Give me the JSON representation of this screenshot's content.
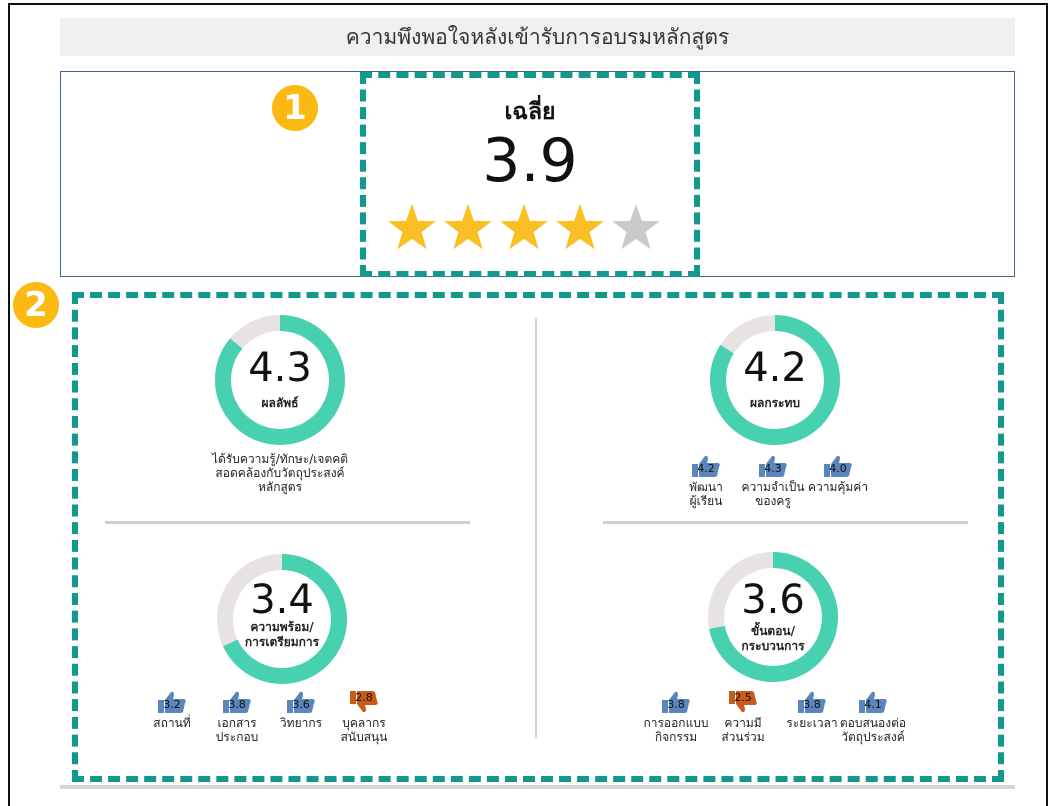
{
  "title": "ความพึงพอใจหลังเข้ารับการอบรมหลักสูตร",
  "average": {
    "label": "เฉลี่ย",
    "value": "3.9",
    "rating": 3.9,
    "stars_filled": 4,
    "stars_total": 5
  },
  "badges": [
    "1",
    "2"
  ],
  "colors": {
    "accent": "#11998e",
    "donut_fill": "#48d1b0",
    "donut_track": "#e8e3e3",
    "star_on": "#fbbf24",
    "star_off": "#c9c9c9",
    "thumb_up": "#5b86bb",
    "thumb_down": "#c75b17"
  },
  "panels": [
    {
      "value": "4.3",
      "score": 4.3,
      "label_lines": [
        "ผลลัพธ์"
      ],
      "description": [
        "ได้รับความรู้/ทักษะ/เจตคติ",
        "สอดคล้องกับวัตถุประสงค์",
        "หลักสูตร"
      ],
      "metrics": []
    },
    {
      "value": "4.2",
      "score": 4.2,
      "label_lines": [
        "ผลกระทบ"
      ],
      "description": [],
      "metrics": [
        {
          "value": "4.2",
          "label": [
            "พัฒนา",
            "ผู้เรียน"
          ],
          "thumb": "up"
        },
        {
          "value": "4.3",
          "label": [
            "ความจำเป็น",
            "ของครู"
          ],
          "thumb": "up"
        },
        {
          "value": "4.0",
          "label": [
            "ความคุ้มค่า"
          ],
          "thumb": "up"
        }
      ]
    },
    {
      "value": "3.4",
      "score": 3.4,
      "label_lines": [
        "ความพร้อม/",
        "การเตรียมการ"
      ],
      "description": [],
      "metrics": [
        {
          "value": "3.2",
          "label": [
            "สถานที่"
          ],
          "thumb": "up"
        },
        {
          "value": "3.8",
          "label": [
            "เอกสาร",
            "ประกอบ"
          ],
          "thumb": "up"
        },
        {
          "value": "3.6",
          "label": [
            "วิทยากร"
          ],
          "thumb": "up"
        },
        {
          "value": "2.8",
          "label": [
            "บุคลากร",
            "สนับสนุน"
          ],
          "thumb": "down"
        }
      ]
    },
    {
      "value": "3.6",
      "score": 3.6,
      "label_lines": [
        "ขั้นตอน/",
        "กระบวนการ"
      ],
      "description": [],
      "metrics": [
        {
          "value": "3.8",
          "label": [
            "การออกแบบ",
            "กิจกรรม"
          ],
          "thumb": "up"
        },
        {
          "value": "2.5",
          "label": [
            "ความมี",
            "ส่วนร่วม"
          ],
          "thumb": "down"
        },
        {
          "value": "3.8",
          "label": [
            "ระยะเวลา"
          ],
          "thumb": "up"
        },
        {
          "value": "4.1",
          "label": [
            "ตอบสนองต่อ",
            "วัตถุประสงค์"
          ],
          "thumb": "up"
        }
      ]
    }
  ]
}
